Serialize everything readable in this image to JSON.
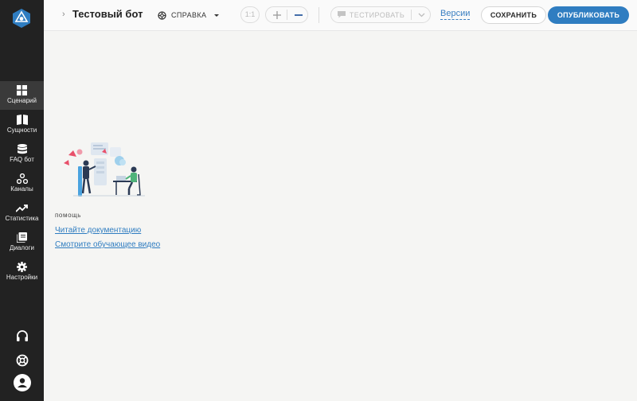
{
  "sidebar": {
    "items": [
      {
        "label": "Сценарий",
        "icon": "grid-icon",
        "active": true
      },
      {
        "label": "Сущности",
        "icon": "book-icon",
        "active": false
      },
      {
        "label": "FAQ бот",
        "icon": "database-icon",
        "active": false
      },
      {
        "label": "Каналы",
        "icon": "channels-icon",
        "active": false
      },
      {
        "label": "Статистика",
        "icon": "trend-icon",
        "active": false
      },
      {
        "label": "Диалоги",
        "icon": "dialogs-icon",
        "active": false
      },
      {
        "label": "Настройки",
        "icon": "gear-icon",
        "active": false
      }
    ],
    "bottom_icons": [
      "headset-icon",
      "lifebuoy-icon",
      "avatar-icon"
    ]
  },
  "header": {
    "bot_title": "Тестовый бот",
    "help_menu": "СПРАВКА",
    "zoom_reset": "1:1",
    "test_button": "ТЕСТИРОВАТЬ",
    "versions_link": "Версии",
    "save_button": "СОХРАНИТЬ",
    "publish_button": "ОПУБЛИКОВАТЬ"
  },
  "help_panel": {
    "heading": "помощь",
    "links": [
      "Читайте документацию",
      "Смотрите обучающее видео"
    ]
  },
  "colors": {
    "sidebar_bg": "#222222",
    "accent": "#2f7dc1",
    "canvas_bg": "#f5f5f3"
  }
}
